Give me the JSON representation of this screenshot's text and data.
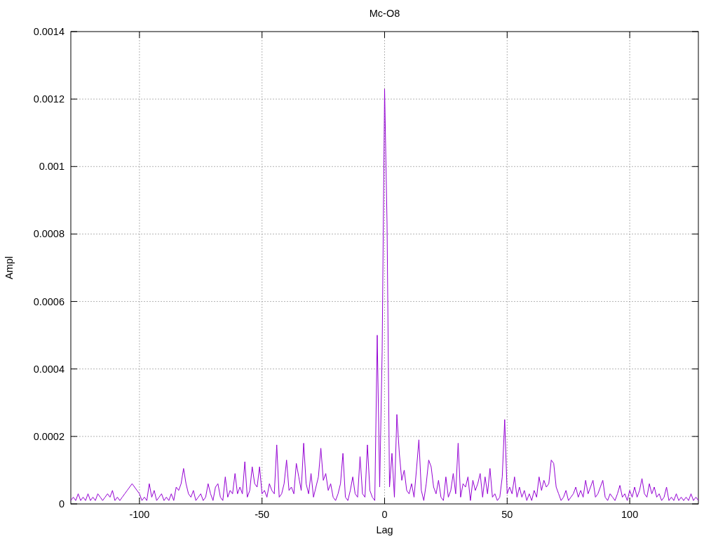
{
  "chart_data": {
    "type": "line",
    "title": "Mc-O8",
    "xlabel": "Lag",
    "ylabel": "Ampl",
    "grid": true,
    "xlim": [
      -128,
      128
    ],
    "x": [
      -128,
      -127,
      -126,
      -125,
      -124,
      -123,
      -122,
      -121,
      -120,
      -119,
      -118,
      -117,
      -116,
      -115,
      -114,
      -113,
      -112,
      -111,
      -110,
      -109,
      -108,
      -107,
      -106,
      -105,
      -104,
      -103,
      -102,
      -101,
      -100,
      -99,
      -98,
      -97,
      -96,
      -95,
      -94,
      -93,
      -92,
      -91,
      -90,
      -89,
      -88,
      -87,
      -86,
      -85,
      -84,
      -83,
      -82,
      -81,
      -80,
      -79,
      -78,
      -77,
      -76,
      -75,
      -74,
      -73,
      -72,
      -71,
      -70,
      -69,
      -68,
      -67,
      -66,
      -65,
      -64,
      -63,
      -62,
      -61,
      -60,
      -59,
      -58,
      -57,
      -56,
      -55,
      -54,
      -53,
      -52,
      -51,
      -50,
      -49,
      -48,
      -47,
      -46,
      -45,
      -44,
      -43,
      -42,
      -41,
      -40,
      -39,
      -38,
      -37,
      -36,
      -35,
      -34,
      -33,
      -32,
      -31,
      -30,
      -29,
      -28,
      -27,
      -26,
      -25,
      -24,
      -23,
      -22,
      -21,
      -20,
      -19,
      -18,
      -17,
      -16,
      -15,
      -14,
      -13,
      -12,
      -11,
      -10,
      -9,
      -8,
      -7,
      -6,
      -5,
      -4,
      -3,
      -2,
      -1,
      0,
      1,
      2,
      3,
      4,
      5,
      6,
      7,
      8,
      9,
      10,
      11,
      12,
      13,
      14,
      15,
      16,
      17,
      18,
      19,
      20,
      21,
      22,
      23,
      24,
      25,
      26,
      27,
      28,
      29,
      30,
      31,
      32,
      33,
      34,
      35,
      36,
      37,
      38,
      39,
      40,
      41,
      42,
      43,
      44,
      45,
      46,
      47,
      48,
      49,
      50,
      51,
      52,
      53,
      54,
      55,
      56,
      57,
      58,
      59,
      60,
      61,
      62,
      63,
      64,
      65,
      66,
      67,
      68,
      69,
      70,
      71,
      72,
      73,
      74,
      75,
      76,
      77,
      78,
      79,
      80,
      81,
      82,
      83,
      84,
      85,
      86,
      87,
      88,
      89,
      90,
      91,
      92,
      93,
      94,
      95,
      96,
      97,
      98,
      99,
      100,
      101,
      102,
      103,
      104,
      105,
      106,
      107,
      108,
      109,
      110,
      111,
      112,
      113,
      114,
      115,
      116,
      117,
      118,
      119,
      120,
      121,
      122,
      123,
      124,
      125,
      126,
      127,
      128
    ],
    "ylim": [
      0,
      0.0014
    ],
    "xticks": [
      -100,
      -50,
      0,
      50,
      100
    ],
    "yticks": [
      0,
      0.0002,
      0.0004,
      0.0006,
      0.0008,
      0.001,
      0.0012,
      0.0014
    ],
    "series": [
      {
        "color": "#9400d3",
        "values": [
          1e-05,
          2e-05,
          1e-05,
          3e-05,
          1e-05,
          2e-05,
          1e-05,
          3e-05,
          1e-05,
          2e-05,
          1e-05,
          3e-05,
          2e-05,
          1e-05,
          2e-05,
          3e-05,
          2e-05,
          4e-05,
          1e-05,
          2e-05,
          1e-05,
          2e-05,
          3e-05,
          4e-05,
          5e-05,
          6e-05,
          5e-05,
          4e-05,
          3e-05,
          1e-05,
          2e-05,
          1e-05,
          6e-05,
          2e-05,
          4e-05,
          1e-05,
          2e-05,
          3e-05,
          1e-05,
          2e-05,
          1e-05,
          3e-05,
          1e-05,
          5e-05,
          4e-05,
          6e-05,
          0.000105,
          6e-05,
          3e-05,
          2e-05,
          4e-05,
          1e-05,
          2e-05,
          3e-05,
          1e-05,
          2e-05,
          6e-05,
          3e-05,
          1e-05,
          5e-05,
          6e-05,
          2e-05,
          1e-05,
          8e-05,
          2e-05,
          4e-05,
          3e-05,
          9e-05,
          3e-05,
          5e-05,
          3e-05,
          0.000125,
          2e-05,
          4e-05,
          0.00011,
          6e-05,
          5e-05,
          0.00011,
          3e-05,
          4e-05,
          2e-05,
          6e-05,
          4e-05,
          3e-05,
          0.000175,
          2e-05,
          3e-05,
          6e-05,
          0.00013,
          4e-05,
          5e-05,
          3e-05,
          0.00012,
          8e-05,
          4e-05,
          0.00018,
          6e-05,
          3e-05,
          9e-05,
          2e-05,
          5e-05,
          8e-05,
          0.000165,
          7e-05,
          9e-05,
          4e-05,
          6e-05,
          2e-05,
          1e-05,
          3e-05,
          6e-05,
          0.00015,
          2e-05,
          1e-05,
          4e-05,
          8e-05,
          3e-05,
          2e-05,
          0.00014,
          3e-05,
          2e-05,
          0.000175,
          4e-05,
          2e-05,
          1e-05,
          0.0005,
          5e-05,
          0.00045,
          0.00123,
          0.00083,
          5e-05,
          0.00015,
          2e-05,
          0.000265,
          0.00015,
          7e-05,
          0.0001,
          4e-05,
          3e-05,
          6e-05,
          2e-05,
          0.0001,
          0.00019,
          4e-05,
          1e-05,
          6e-05,
          0.00013,
          0.00011,
          5e-05,
          3e-05,
          7e-05,
          2e-05,
          1e-05,
          8e-05,
          2e-05,
          4e-05,
          9e-05,
          3e-05,
          0.00018,
          2e-05,
          6e-05,
          5e-05,
          8e-05,
          1e-05,
          7e-05,
          4e-05,
          6e-05,
          9e-05,
          2e-05,
          8e-05,
          3e-05,
          0.000105,
          2e-05,
          3e-05,
          1e-05,
          2e-05,
          8e-05,
          0.00025,
          3e-05,
          5e-05,
          3e-05,
          8e-05,
          2e-05,
          5e-05,
          2e-05,
          4e-05,
          1e-05,
          3e-05,
          1e-05,
          4e-05,
          2e-05,
          8e-05,
          4e-05,
          7e-05,
          5e-05,
          6e-05,
          0.00013,
          0.00012,
          5e-05,
          3e-05,
          1e-05,
          2e-05,
          4e-05,
          1e-05,
          2e-05,
          3e-05,
          5e-05,
          2e-05,
          4e-05,
          2e-05,
          7e-05,
          3e-05,
          5e-05,
          7e-05,
          2e-05,
          3e-05,
          5e-05,
          7e-05,
          2e-05,
          1e-05,
          3e-05,
          2e-05,
          1e-05,
          3e-05,
          5.5e-05,
          2e-05,
          3e-05,
          1e-05,
          4e-05,
          2e-05,
          5e-05,
          2e-05,
          4e-05,
          7.5e-05,
          3e-05,
          2e-05,
          6e-05,
          3e-05,
          5e-05,
          2e-05,
          3e-05,
          1e-05,
          2e-05,
          5e-05,
          1e-05,
          2e-05,
          1e-05,
          3e-05,
          1e-05,
          2e-05,
          1e-05,
          2e-05,
          1e-05,
          3e-05,
          1e-05,
          2e-05,
          1e-05
        ]
      }
    ]
  }
}
